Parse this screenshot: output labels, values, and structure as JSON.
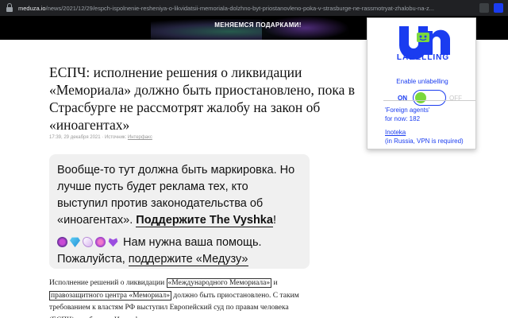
{
  "browser": {
    "url_host": "meduza.io",
    "url_path": "/news/2021/12/29/espch-ispolnenie-resheniya-o-likvidatsii-memoriala-dolzhno-byt-priostanovleno-poka-v-strasburge-ne-rassmotryat-zhalobu-na-z..."
  },
  "banner": {
    "text": "МЕНЯЕМСЯ ПОДАРКАМИ!"
  },
  "article": {
    "headline": "ЕСПЧ: исполнение решения о ликвидации «Мемориала» должно быть приостановлено, пока в Страсбурге не рассмотрят жалобу на закон об «иноагентах»",
    "meta_date": "17:39, 29 декабря 2021",
    "meta_source_label": "Источник:",
    "meta_source": "Интерфакс",
    "promo": {
      "p1_text": "Вообще-то тут должна быть маркировка. Но лучше пусть будет реклама тех, кто выступил против законодательства об «иноагентах». ",
      "p1_link": "Поддержите The Vyshka",
      "p1_end": "!",
      "p2_text": " Нам нужна ваша помощь. Пожалуйста, ",
      "p2_link": "поддержите «Медузу»"
    },
    "body": {
      "t1": "Исполнение решений о ликвидации ",
      "b1": "«Международного Мемориала»",
      "t2": " и ",
      "b2": "правозащитного центра «Мемориал»",
      "t3": " должно быть приостановлено. С таким требованием к властям РФ выступил Европейский суд по правам человека (ЕСПЧ), сообщает «Интерфакс»."
    }
  },
  "extension": {
    "logo_text": "LABELLING",
    "enable_label": "Enable unlabelling",
    "on_label": "ON",
    "off_label": "OFF",
    "toggle_on": true,
    "foreign_agents_line1": "'Foreign agents'",
    "foreign_agents_line2": "for now: 182",
    "inoteka_link": "Inoteka",
    "inoteka_note": "(in Russia, VPN is required)",
    "brand_color": "#1a3cf0",
    "toggle_color": "#7bd83c"
  }
}
